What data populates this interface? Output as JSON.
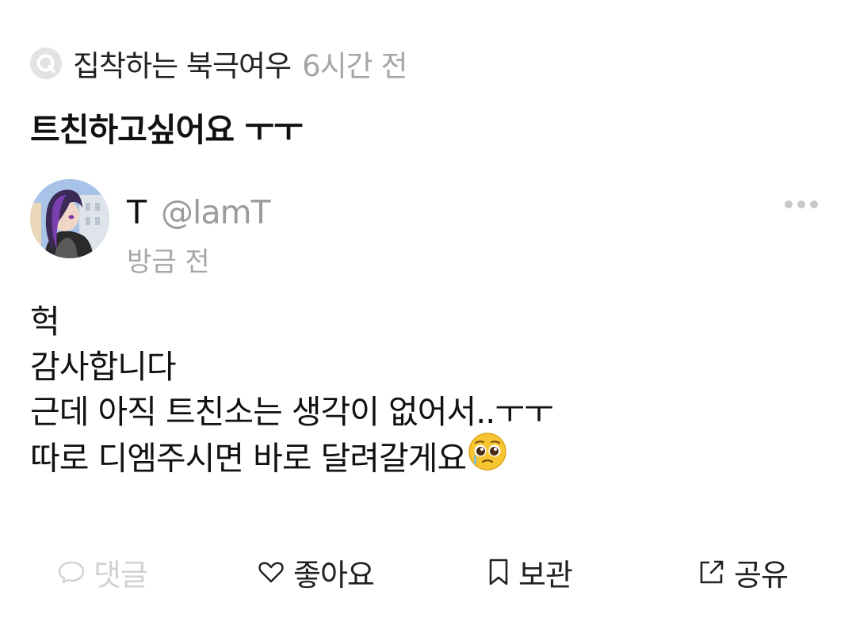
{
  "question": {
    "badge_icon": "q-badge-icon",
    "author": "집착하는 북극여우",
    "time": "6시간 전",
    "text": "트친하고싶어요 ㅜㅜ"
  },
  "answer": {
    "avatar": "user-avatar-image",
    "name": "T",
    "handle": "@lamT",
    "time": "방금 전",
    "lines": [
      "헉",
      "감사합니다",
      "근데 아직 트친소는 생각이 없어서..ㅜㅜ",
      "따로 디엠주시면 바로 달려갈게요"
    ],
    "trailing_emoji": "pleading-face-emoji"
  },
  "actions": {
    "comment": "댓글",
    "like": "좋아요",
    "save": "보관",
    "share": "공유"
  },
  "colors": {
    "muted_text": "#a6a6a6",
    "disabled_text": "#d2d2d2",
    "primary_text": "#111111"
  }
}
